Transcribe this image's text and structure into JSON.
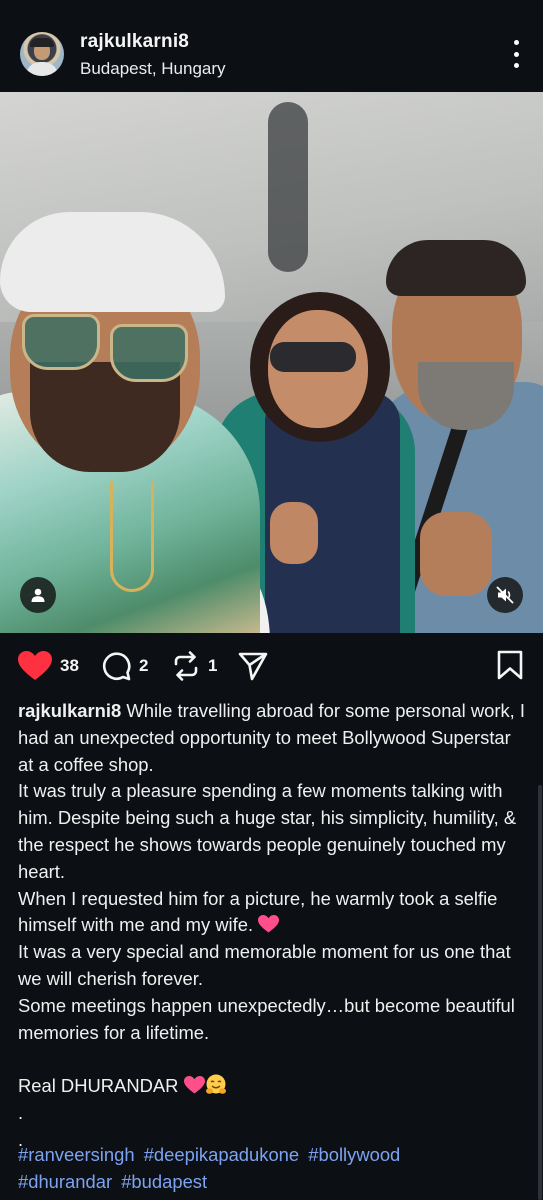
{
  "post": {
    "username": "rajkulkarni8",
    "location": "Budapest, Hungary",
    "more_icon": "more-vertical-icon"
  },
  "actions": {
    "likes": "38",
    "comments": "2",
    "reposts": "1",
    "like_color": "#ff3040"
  },
  "caption": {
    "username": "rajkulkarni8",
    "lines": [
      "While travelling abroad for some personal work, I had an unexpected opportunity to meet Bollywood Superstar at a coffee shop.",
      "It was truly a pleasure spending a few moments talking with him. Despite being such a huge star, his simplicity, humility, & the respect he shows towards people genuinely touched my heart.",
      "When I requested him for a picture, he warmly took a selfie himself with me and my wife.",
      "It was a very special and memorable moment for us one that we will cherish forever.",
      "Some meetings happen unexpectedly…but become beautiful memories for a lifetime.",
      "Real DHURANDAR",
      ".",
      "."
    ]
  },
  "hashtags": [
    "#ranveersingh",
    "#deepikapadukone",
    "#bollywood",
    "#dhurandar",
    "#budapest"
  ],
  "colors": {
    "background": "#0c0f14",
    "hashtag": "#7da3f0",
    "text": "#f5f5f5"
  }
}
